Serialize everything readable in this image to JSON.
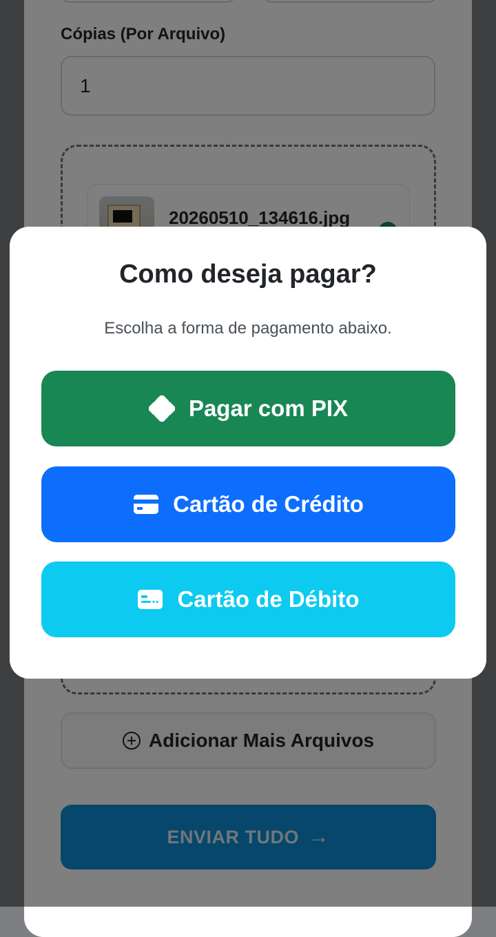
{
  "background_form": {
    "copies_label": "Cópias (Por Arquivo)",
    "copies_value": "1",
    "file_name": "20260510_134616.jpg",
    "add_files_label": "Adicionar Mais Arquivos",
    "send_label": "ENVIAR TUDO",
    "send_icon": "arrow-right-icon"
  },
  "modal": {
    "title": "Como deseja pagar?",
    "subtitle": "Escolha a forma de pagamento abaixo.",
    "options": [
      {
        "label": "Pagar com PIX",
        "icon": "pix-icon",
        "color": "#198754"
      },
      {
        "label": "Cartão de Crédito",
        "icon": "credit-card-icon",
        "color": "#0d6efd"
      },
      {
        "label": "Cartão de Débito",
        "icon": "debit-card-icon",
        "color": "#0dcaf0"
      }
    ]
  },
  "colors": {
    "success": "#198754",
    "primary": "#0d6efd",
    "info": "#0dcaf0",
    "text": "#212529",
    "muted": "#495057"
  }
}
